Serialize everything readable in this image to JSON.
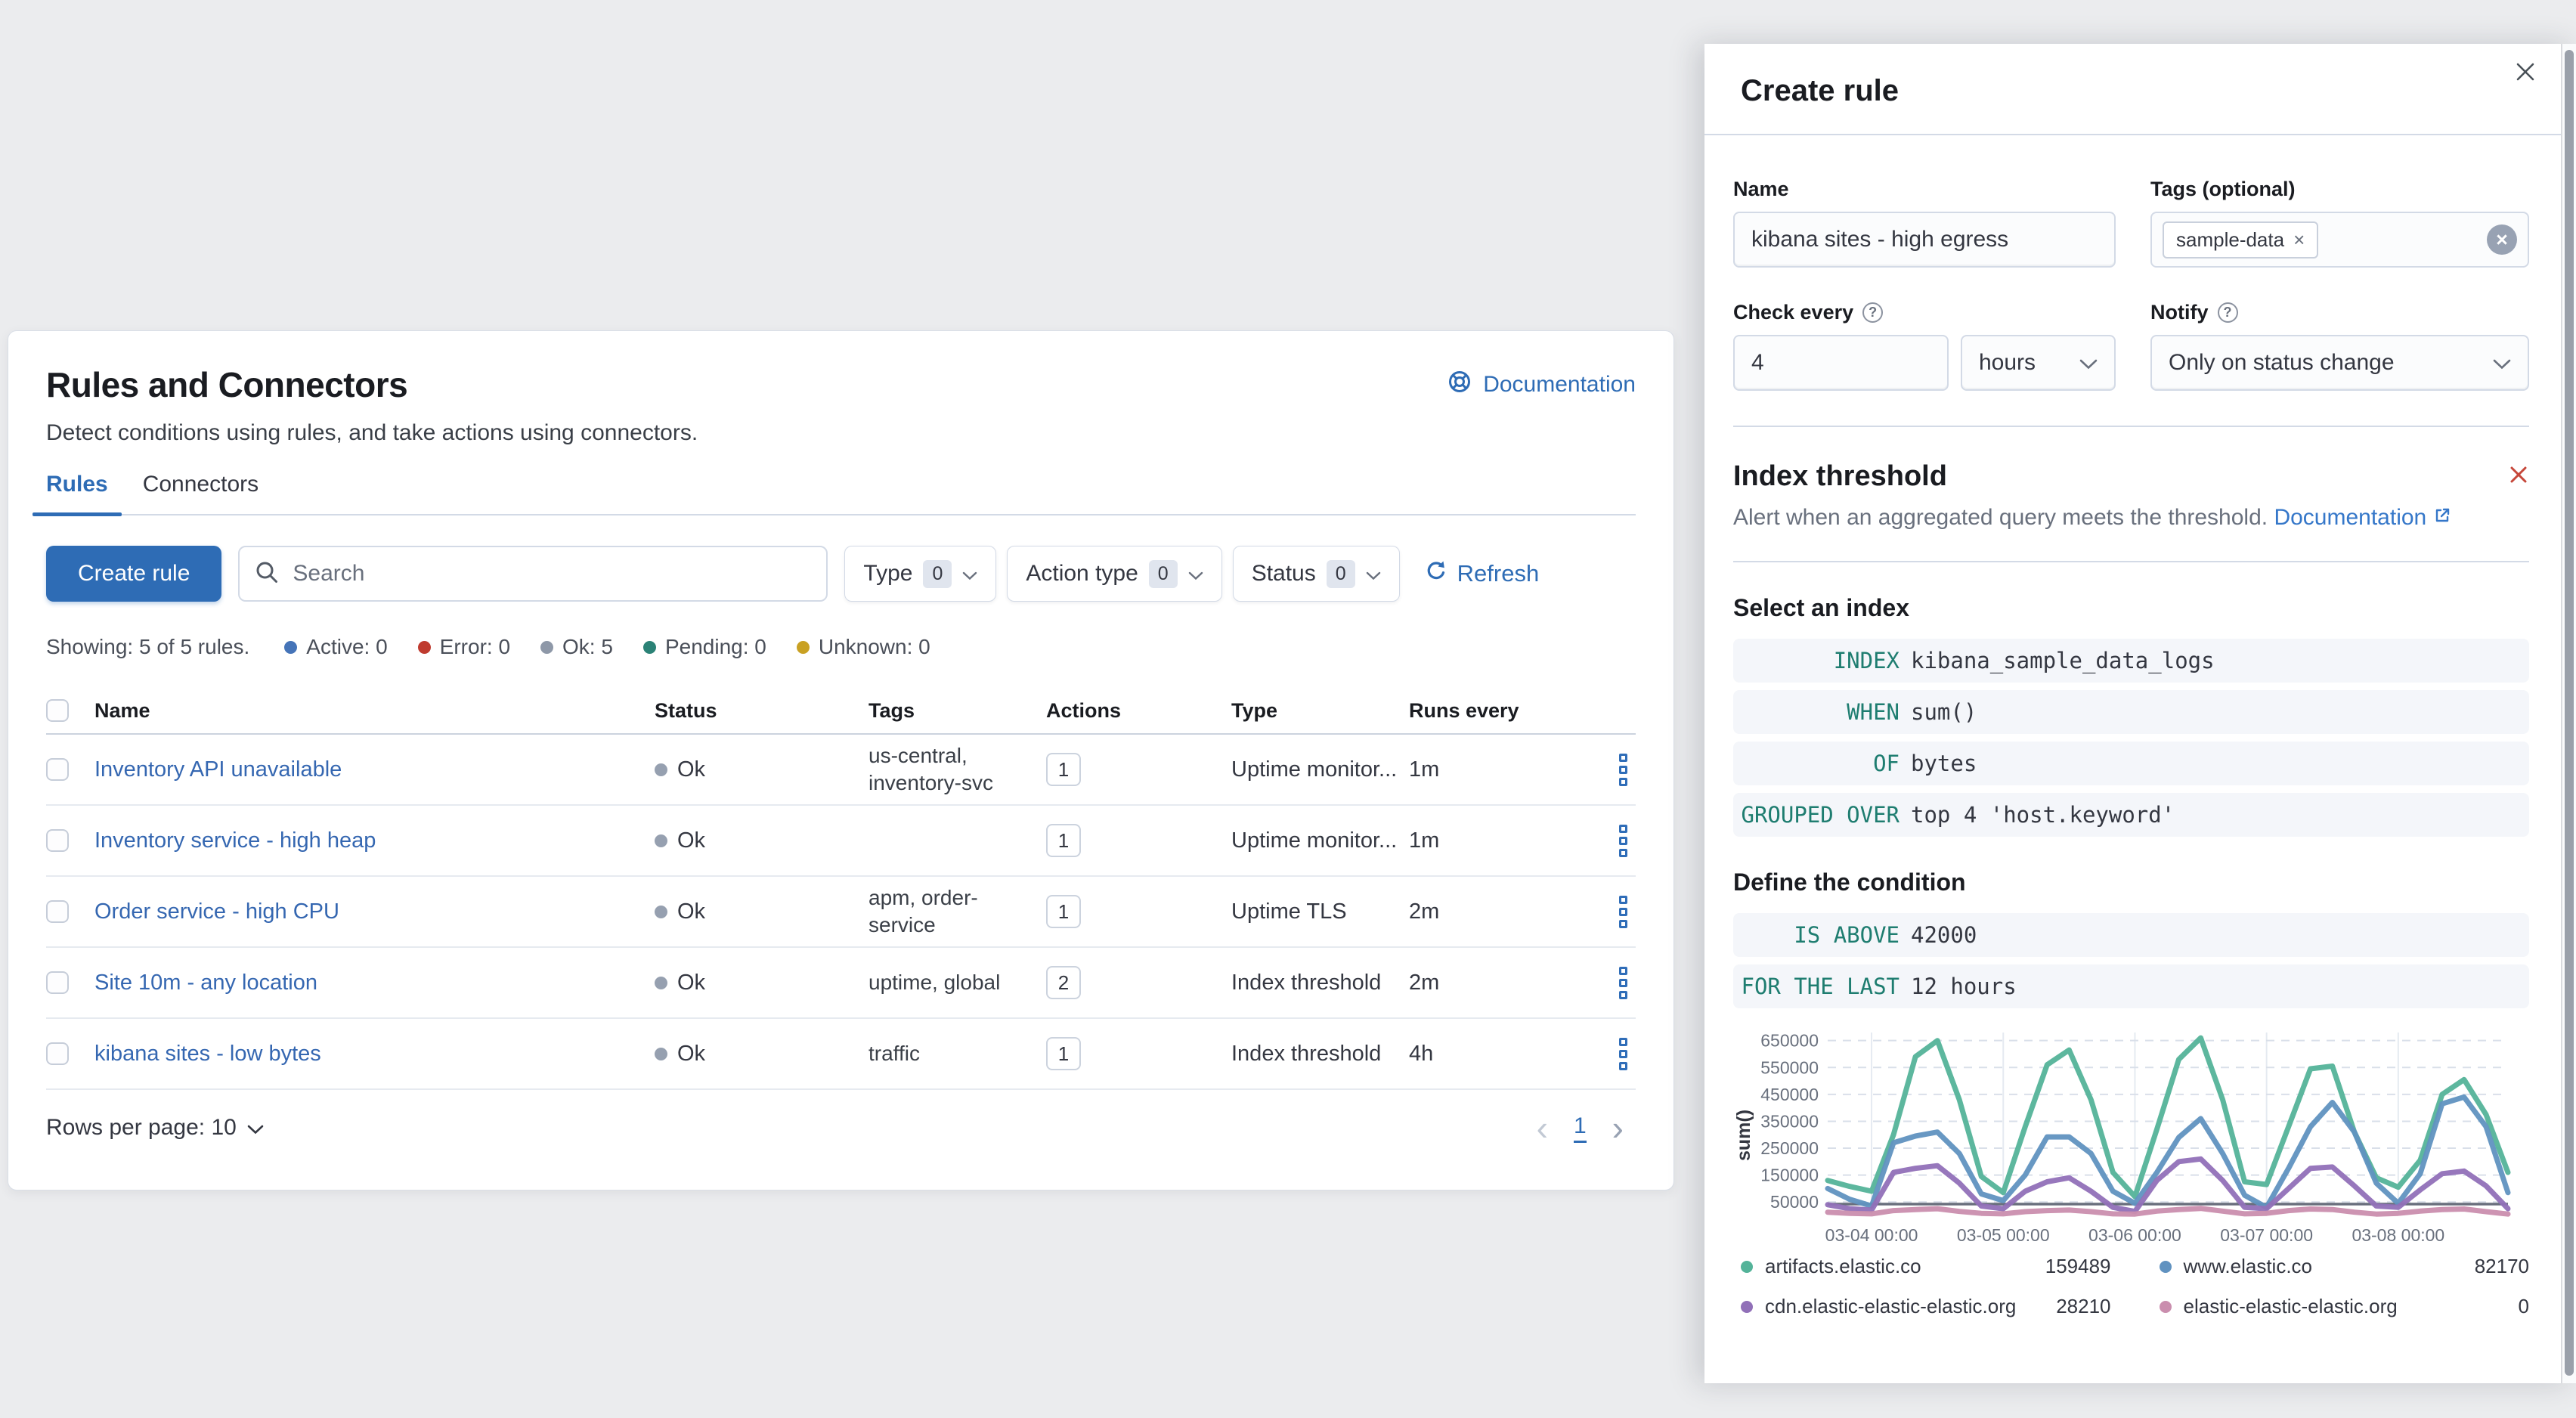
{
  "colors": {
    "accent_blue": "#2e6cb5",
    "link_blue": "#3577c9",
    "keyword_teal": "#1e7d70",
    "remove_red": "#c6473a",
    "threshold_gray": "#696f7d",
    "page_background": "#ebecee"
  },
  "main_panel": {
    "title": "Rules and Connectors",
    "documentation_link": "Documentation",
    "subtitle": "Detect conditions using rules, and take actions using connectors.",
    "tabs": [
      {
        "label": "Rules",
        "active": true
      },
      {
        "label": "Connectors",
        "active": false
      }
    ],
    "toolbar": {
      "create_rule_label": "Create rule",
      "search_placeholder": "Search",
      "filters": [
        {
          "label": "Type",
          "count": "0"
        },
        {
          "label": "Action type",
          "count": "0"
        },
        {
          "label": "Status",
          "count": "0"
        }
      ],
      "refresh_label": "Refresh"
    },
    "summary": {
      "showing": "Showing: 5 of 5 rules.",
      "statuses": [
        {
          "label": "Active: 0",
          "color": "#4574b8"
        },
        {
          "label": "Error: 0",
          "color": "#bf3b2f"
        },
        {
          "label": "Ok: 5",
          "color": "#8e98a8"
        },
        {
          "label": "Pending: 0",
          "color": "#2b8276"
        },
        {
          "label": "Unknown: 0",
          "color": "#c9a123"
        }
      ]
    },
    "table": {
      "columns": [
        "Name",
        "Status",
        "Tags",
        "Actions",
        "Type",
        "Runs every"
      ],
      "rows": [
        {
          "name": "Inventory API unavailable",
          "status": "Ok",
          "tags": "us-central, inventory-svc",
          "actions": "1",
          "type": "Uptime monitor...",
          "runs_every": "1m"
        },
        {
          "name": "Inventory service - high heap",
          "status": "Ok",
          "tags": "",
          "actions": "1",
          "type": "Uptime monitor...",
          "runs_every": "1m"
        },
        {
          "name": "Order service - high CPU",
          "status": "Ok",
          "tags": "apm, order-service",
          "actions": "1",
          "type": "Uptime TLS",
          "runs_every": "2m"
        },
        {
          "name": "Site 10m - any location",
          "status": "Ok",
          "tags": "uptime, global",
          "actions": "2",
          "type": "Index threshold",
          "runs_every": "2m"
        },
        {
          "name": "kibana sites - low bytes",
          "status": "Ok",
          "tags": "traffic",
          "actions": "1",
          "type": "Index threshold",
          "runs_every": "4h"
        }
      ]
    },
    "pagination": {
      "rows_per_page": "Rows per page: 10",
      "page": "1"
    }
  },
  "flyout": {
    "title": "Create rule",
    "name_label": "Name",
    "name_value": "kibana sites - high egress",
    "tags_label": "Tags (optional)",
    "tag_pill": "sample-data",
    "check_every_label": "Check every",
    "check_every_value": "4",
    "check_every_unit": "hours",
    "notify_label": "Notify",
    "notify_value": "Only on status change",
    "rule_type": {
      "heading": "Index threshold",
      "description": "Alert when an aggregated query meets the threshold.",
      "doc_link": "Documentation"
    },
    "select_index": {
      "heading": "Select an index",
      "expressions": [
        {
          "keyword": "INDEX",
          "value": "kibana_sample_data_logs"
        },
        {
          "keyword": "WHEN",
          "value": "sum()"
        },
        {
          "keyword": "OF",
          "value": "bytes"
        },
        {
          "keyword": "GROUPED OVER",
          "value": "top 4 'host.keyword'"
        }
      ]
    },
    "condition": {
      "heading": "Define the condition",
      "expressions": [
        {
          "keyword": "IS ABOVE",
          "value": "42000"
        },
        {
          "keyword": "FOR THE LAST",
          "value": "12 hours"
        }
      ]
    }
  },
  "chart_data": {
    "type": "line",
    "ylabel": "sum()",
    "ylim": [
      0,
      680000
    ],
    "y_ticks": [
      50000,
      150000,
      250000,
      350000,
      450000,
      550000,
      650000
    ],
    "x_tick_labels": [
      "03-04 00:00",
      "03-05 00:00",
      "03-06 00:00",
      "03-07 00:00",
      "03-08 00:00"
    ],
    "x_tick_indices": [
      2,
      8,
      14,
      20,
      26
    ],
    "x_interval": "4h",
    "threshold": 42000,
    "grid": true,
    "legend_position": "bottom",
    "series": [
      {
        "name": "artifacts.elastic.co",
        "color": "#54B399",
        "legend_value": "159489",
        "values": [
          130000,
          108000,
          90000,
          300000,
          590000,
          650000,
          430000,
          145000,
          85000,
          330000,
          560000,
          615000,
          430000,
          160000,
          70000,
          320000,
          580000,
          660000,
          430000,
          125000,
          115000,
          330000,
          545000,
          555000,
          310000,
          140000,
          105000,
          205000,
          450000,
          505000,
          375000,
          160000
        ]
      },
      {
        "name": "www.elastic.co",
        "color": "#6092C0",
        "legend_value": "82170",
        "values": [
          100000,
          60000,
          35000,
          270000,
          295000,
          310000,
          230000,
          80000,
          55000,
          150000,
          292000,
          292000,
          230000,
          90000,
          45000,
          160000,
          290000,
          360000,
          230000,
          75000,
          30000,
          175000,
          330000,
          420000,
          310000,
          120000,
          45000,
          155000,
          415000,
          440000,
          330000,
          85000
        ]
      },
      {
        "name": "cdn.elastic-elastic-elastic.org",
        "color": "#9170B8",
        "legend_value": "28210",
        "values": [
          40000,
          25000,
          20000,
          160000,
          175000,
          185000,
          120000,
          35000,
          25000,
          90000,
          125000,
          140000,
          90000,
          30000,
          15000,
          130000,
          200000,
          210000,
          130000,
          30000,
          25000,
          100000,
          175000,
          180000,
          110000,
          35000,
          30000,
          95000,
          155000,
          165000,
          110000,
          25000
        ]
      },
      {
        "name": "elastic-elastic-elastic.org",
        "color": "#CA8EAE",
        "legend_value": "0",
        "values": [
          12000,
          8000,
          6000,
          18000,
          22000,
          25000,
          15000,
          8000,
          6000,
          14000,
          18000,
          20000,
          14000,
          6000,
          5000,
          16000,
          22000,
          26000,
          16000,
          6000,
          8000,
          18000,
          24000,
          22000,
          12000,
          5000,
          8000,
          16000,
          22000,
          24000,
          14000,
          5000
        ]
      }
    ]
  }
}
